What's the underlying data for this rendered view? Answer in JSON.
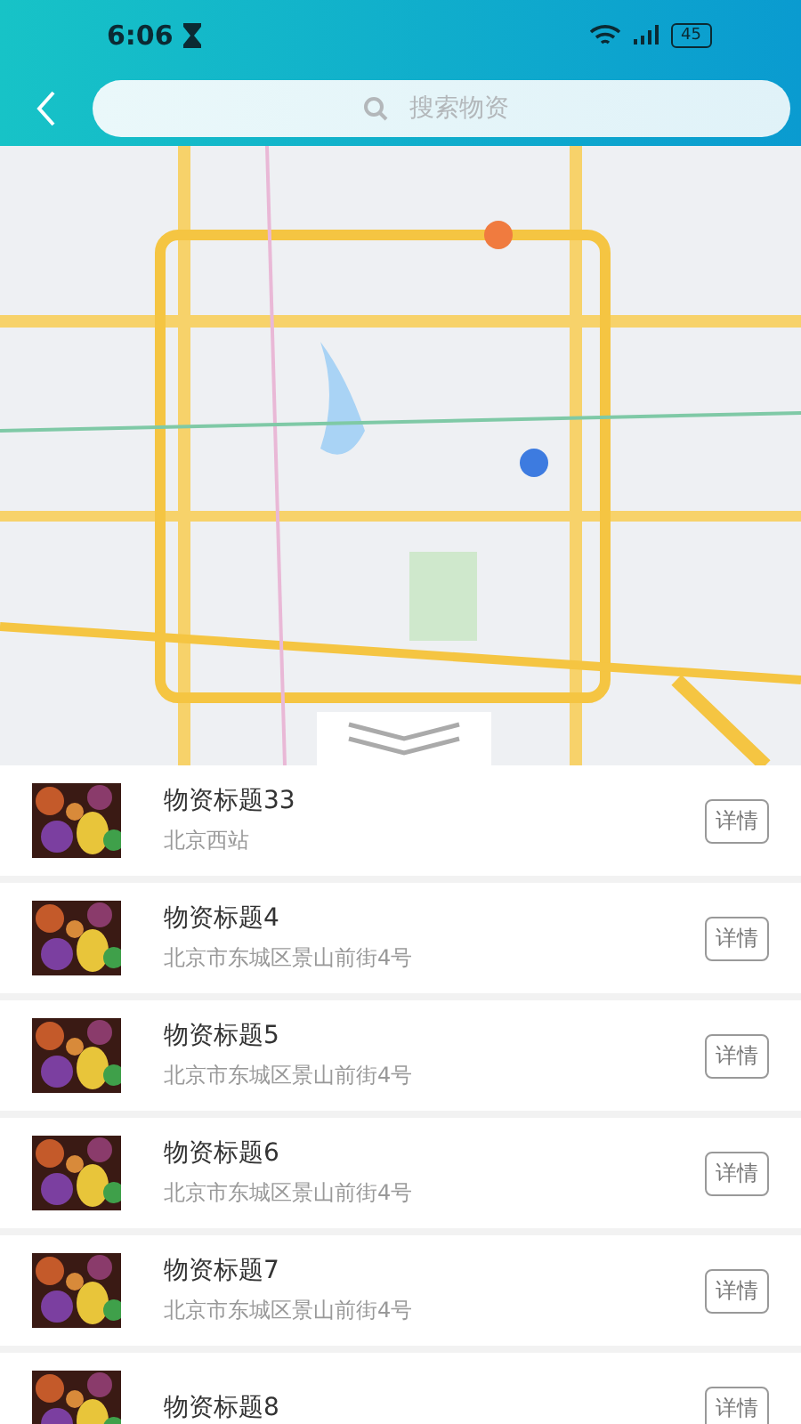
{
  "status_bar": {
    "time": "6:06",
    "battery": "45"
  },
  "search": {
    "placeholder": "搜索物资"
  },
  "items": [
    {
      "title": "物资标题33",
      "address": "北京西站",
      "action": "详情"
    },
    {
      "title": "物资标题4",
      "address": "北京市东城区景山前街4号",
      "action": "详情"
    },
    {
      "title": "物资标题5",
      "address": "北京市东城区景山前街4号",
      "action": "详情"
    },
    {
      "title": "物资标题6",
      "address": "北京市东城区景山前街4号",
      "action": "详情"
    },
    {
      "title": "物资标题7",
      "address": "北京市东城区景山前街4号",
      "action": "详情"
    },
    {
      "title": "物资标题8",
      "action": "详情"
    }
  ]
}
